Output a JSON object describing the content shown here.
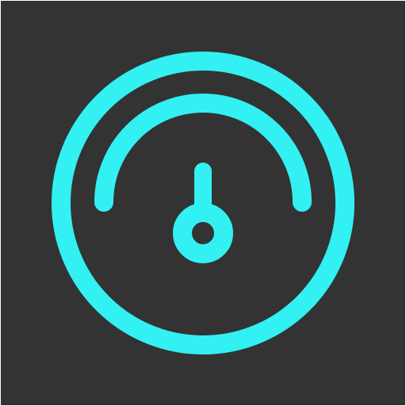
{
  "icon": {
    "name": "gauge-icon",
    "background_color": "#333333",
    "stroke_color": "#33F0F3"
  }
}
